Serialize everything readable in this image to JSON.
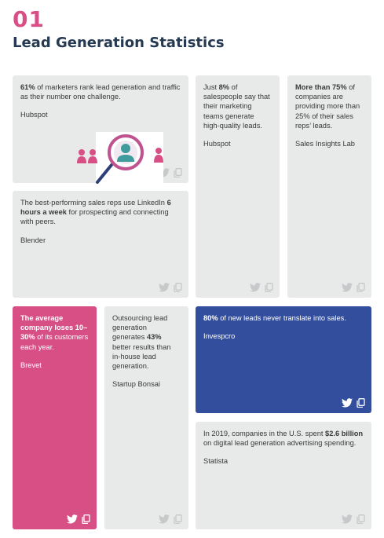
{
  "header": {
    "number": "01",
    "title": "Lead Generation Statistics"
  },
  "cards": [
    {
      "pre": "",
      "bold": "61%",
      "post": " of marketers rank lead generation and traffic as their number one challenge.",
      "source": "Hubspot"
    },
    {
      "pre": "Just ",
      "bold": "8%",
      "post": " of salespeople say that their marketing teams generate high-quality leads.",
      "source": "Hubspot"
    },
    {
      "pre": "",
      "bold": "More than 75%",
      "post": " of companies are providing more than 25% of their sales reps’ leads.",
      "source": "Sales Insights Lab"
    },
    {
      "pre": "The best-performing sales reps use LinkedIn ",
      "bold": "6 hours a week",
      "post": " for prospecting and connecting with peers.",
      "source": "Blender"
    },
    {
      "pre": "",
      "bold": "The average company loses 10–30%",
      "post": " of its customers each year.",
      "source": "Brevet"
    },
    {
      "pre": "Outsourcing lead generation generates ",
      "bold": "43%",
      "post": " better results than in-house lead generation.",
      "source": "Startup Bonsai"
    },
    {
      "pre": "",
      "bold": "80%",
      "post": " of new leads never translate into sales.",
      "source": "Invespcro"
    },
    {
      "pre": "In 2019, companies in the U.S. spent ",
      "bold": "$2.6 billion",
      "post": " on digital lead generation advertising spending.",
      "source": "Statista"
    }
  ],
  "icons": {
    "share": "twitter-icon",
    "copy": "copy-icon",
    "illustration": "magnifier-people-icon"
  },
  "colors": {
    "accent": "#d84f86",
    "title": "#253a52",
    "card": "#e8e9e9",
    "blue": "#324e9d"
  }
}
